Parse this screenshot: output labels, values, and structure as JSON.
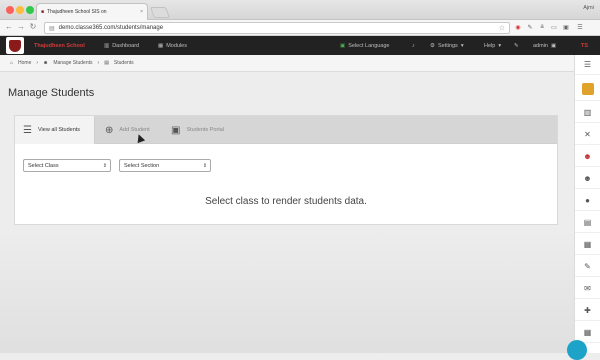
{
  "browser": {
    "tab_title": "Thajudheen School SIS on",
    "url": "demo.classe365.com/students/manage",
    "profile_name": "Ajmi"
  },
  "appbar": {
    "school_name": "Thajudheen School",
    "dashboard": "Dashboard",
    "modules": "Modules",
    "select_language": "Select Language",
    "settings": "Settings",
    "help": "Help",
    "user": "admin"
  },
  "breadcrumb": {
    "home": "Home",
    "manage_students": "Manage Students",
    "students": "Students"
  },
  "page": {
    "title": "Manage Students"
  },
  "tabs": {
    "view_all": "View all Students",
    "add": "Add Student",
    "portal": "Students Portal"
  },
  "filters": {
    "class": "Select Class",
    "section": "Select Section"
  },
  "message": "Select class to render students data.",
  "colors": {
    "accent": "#c62828",
    "appbar_bg": "#222222",
    "fab": "#1ea3c8"
  }
}
